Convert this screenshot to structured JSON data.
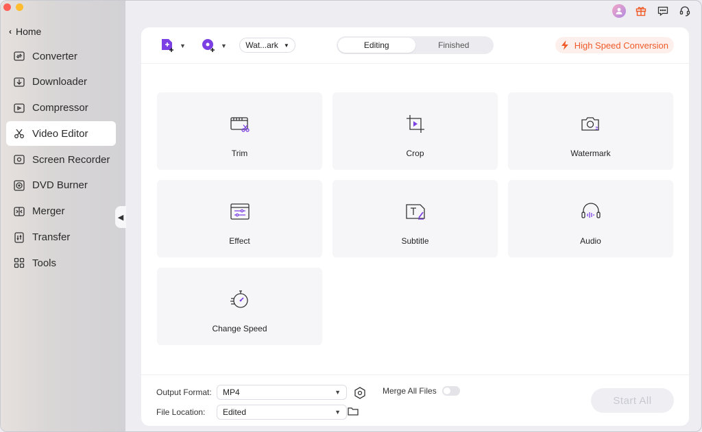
{
  "window": {
    "traffic_lights": [
      "close",
      "minimize"
    ]
  },
  "sidebar": {
    "home_label": "Home",
    "items": [
      {
        "label": "Converter",
        "icon": "converter-icon"
      },
      {
        "label": "Downloader",
        "icon": "downloader-icon"
      },
      {
        "label": "Compressor",
        "icon": "compressor-icon"
      },
      {
        "label": "Video Editor",
        "icon": "scissors-icon",
        "active": true
      },
      {
        "label": "Screen Recorder",
        "icon": "screen-recorder-icon"
      },
      {
        "label": "DVD Burner",
        "icon": "dvd-icon"
      },
      {
        "label": "Merger",
        "icon": "merger-icon"
      },
      {
        "label": "Transfer",
        "icon": "transfer-icon"
      },
      {
        "label": "Tools",
        "icon": "tools-icon"
      }
    ]
  },
  "topbar": {
    "icons": [
      "avatar-icon",
      "gift-icon",
      "feedback-icon",
      "support-headset-icon"
    ]
  },
  "toolbar": {
    "preset_label": "Wat...ark",
    "tabs": [
      {
        "label": "Editing",
        "active": true
      },
      {
        "label": "Finished",
        "active": false
      }
    ],
    "high_speed_label": "High Speed Conversion"
  },
  "tools": [
    {
      "label": "Trim",
      "icon": "trim-icon"
    },
    {
      "label": "Crop",
      "icon": "crop-icon"
    },
    {
      "label": "Watermark",
      "icon": "watermark-icon"
    },
    {
      "label": "Effect",
      "icon": "effect-icon"
    },
    {
      "label": "Subtitle",
      "icon": "subtitle-icon"
    },
    {
      "label": "Audio",
      "icon": "audio-icon"
    },
    {
      "label": "Change Speed",
      "icon": "speed-icon"
    }
  ],
  "footer": {
    "output_format_label": "Output Format:",
    "output_format_value": "MP4",
    "file_location_label": "File Location:",
    "file_location_value": "Edited",
    "merge_label": "Merge All Files",
    "merge_on": false,
    "start_label": "Start  All"
  },
  "colors": {
    "accent_purple": "#7b3fe4",
    "brand_orange": "#f05a28",
    "active_nav_bg": "#ffffff"
  }
}
